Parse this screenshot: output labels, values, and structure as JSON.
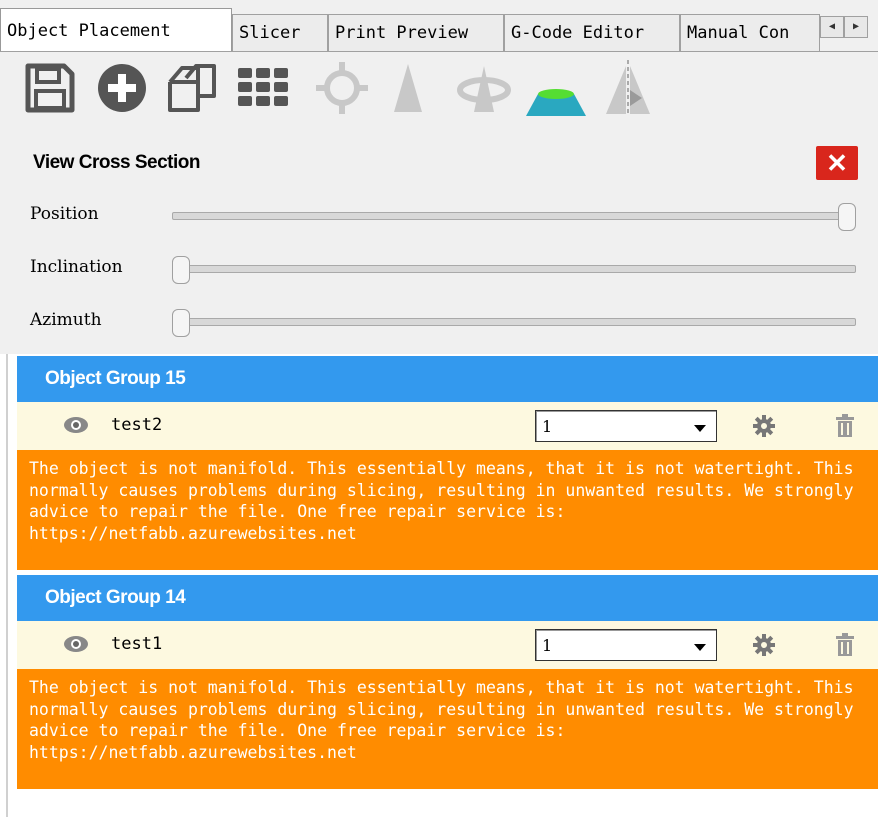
{
  "tabs": [
    {
      "label": "Object Placement",
      "active": true
    },
    {
      "label": "Slicer",
      "active": false
    },
    {
      "label": "Print Preview",
      "active": false
    },
    {
      "label": "G-Code Editor",
      "active": false
    },
    {
      "label": "Manual Con",
      "active": false
    }
  ],
  "tab_scroll": {
    "left": "◀",
    "right": "▶"
  },
  "toolbar": {
    "icons": [
      "save-icon",
      "add-object-icon",
      "copy-object-icon",
      "arrange-grid-icon",
      "center-object-icon",
      "autoposition-icon",
      "rotate-view-icon",
      "cut-object-icon",
      "mirror-icon"
    ]
  },
  "cross_section": {
    "title": "View Cross Section",
    "close_label": "✕",
    "sliders": [
      {
        "label": "Position",
        "value": 1.0
      },
      {
        "label": "Inclination",
        "value": 0.0
      },
      {
        "label": "Azimuth",
        "value": 0.0
      }
    ]
  },
  "groups": [
    {
      "header": "Object Group 15",
      "object_name": "test2",
      "select_value": "1",
      "warning": "The object is not manifold. This essentially means, that it is not watertight. This normally causes problems during slicing, resulting in unwanted results. We strongly advice to repair the file. One free repair service is: https://netfabb.azurewebsites.net"
    },
    {
      "header": "Object Group 14",
      "object_name": "test1",
      "select_value": "1",
      "warning": "The object is not manifold. This essentially means, that it is not watertight. This normally causes problems during slicing, resulting in unwanted results. We strongly advice to repair the file. One free repair service is: https://netfabb.azurewebsites.net"
    }
  ],
  "colors": {
    "group_header": "#3399ee",
    "warning_bg": "#ff8c00",
    "row_bg": "#fdf9e0",
    "close_button": "#d9261c",
    "cut_icon": "#2aa8c0"
  }
}
